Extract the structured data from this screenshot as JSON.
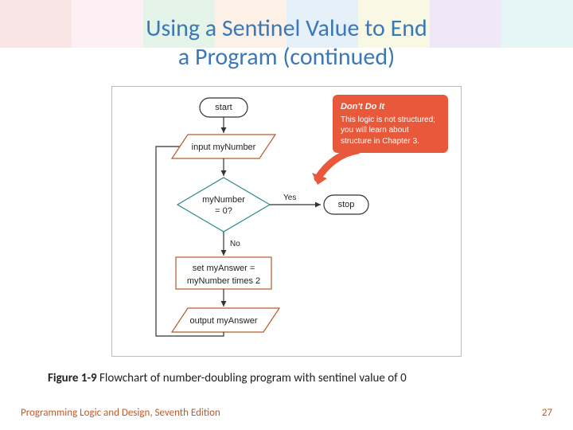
{
  "title_line1": "Using a Sentinel Value to End",
  "title_line2": "a Program (continued)",
  "flowchart": {
    "start": "start",
    "input": "input myNumber",
    "decision_line1": "myNumber",
    "decision_line2": "= 0?",
    "yes": "Yes",
    "no": "No",
    "process_line1": "set myAnswer =",
    "process_line2": "myNumber times 2",
    "output": "output myAnswer",
    "stop": "stop"
  },
  "callout": {
    "head": "Don't Do It",
    "body": "This logic is not structured; you will learn about structure in Chapter 3."
  },
  "caption_fignum": "Figure 1-9",
  "caption_text": " Flowchart of number-doubling program with sentinel value of 0",
  "footer_left": "Programming Logic and Design, Seventh Edition",
  "footer_right": "27",
  "stripe_colors": [
    "#d33",
    "#e8a",
    "#3a5",
    "#e84",
    "#38c",
    "#cc3",
    "#84c",
    "#3aa"
  ]
}
